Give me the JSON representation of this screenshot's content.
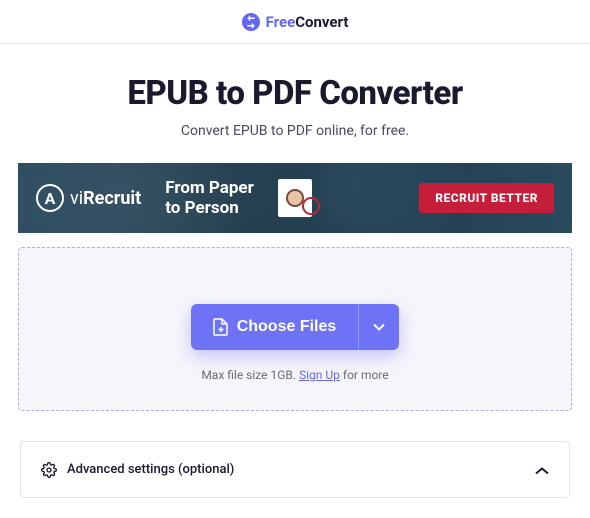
{
  "header": {
    "logo_free": "Free",
    "logo_convert": "Convert"
  },
  "page": {
    "title": "EPUB to PDF Converter",
    "subtitle": "Convert EPUB to PDF online, for free."
  },
  "ad": {
    "brand_vi": "vi",
    "brand_recruit": "Recruit",
    "slogan_line1": "From Paper",
    "slogan_line2": "to Person",
    "cta": "RECRUIT BETTER"
  },
  "uploader": {
    "choose_label": "Choose Files",
    "hint_prefix": "Max file size 1GB. ",
    "hint_link": "Sign Up",
    "hint_suffix": " for more"
  },
  "advanced": {
    "label": "Advanced settings (optional)"
  }
}
